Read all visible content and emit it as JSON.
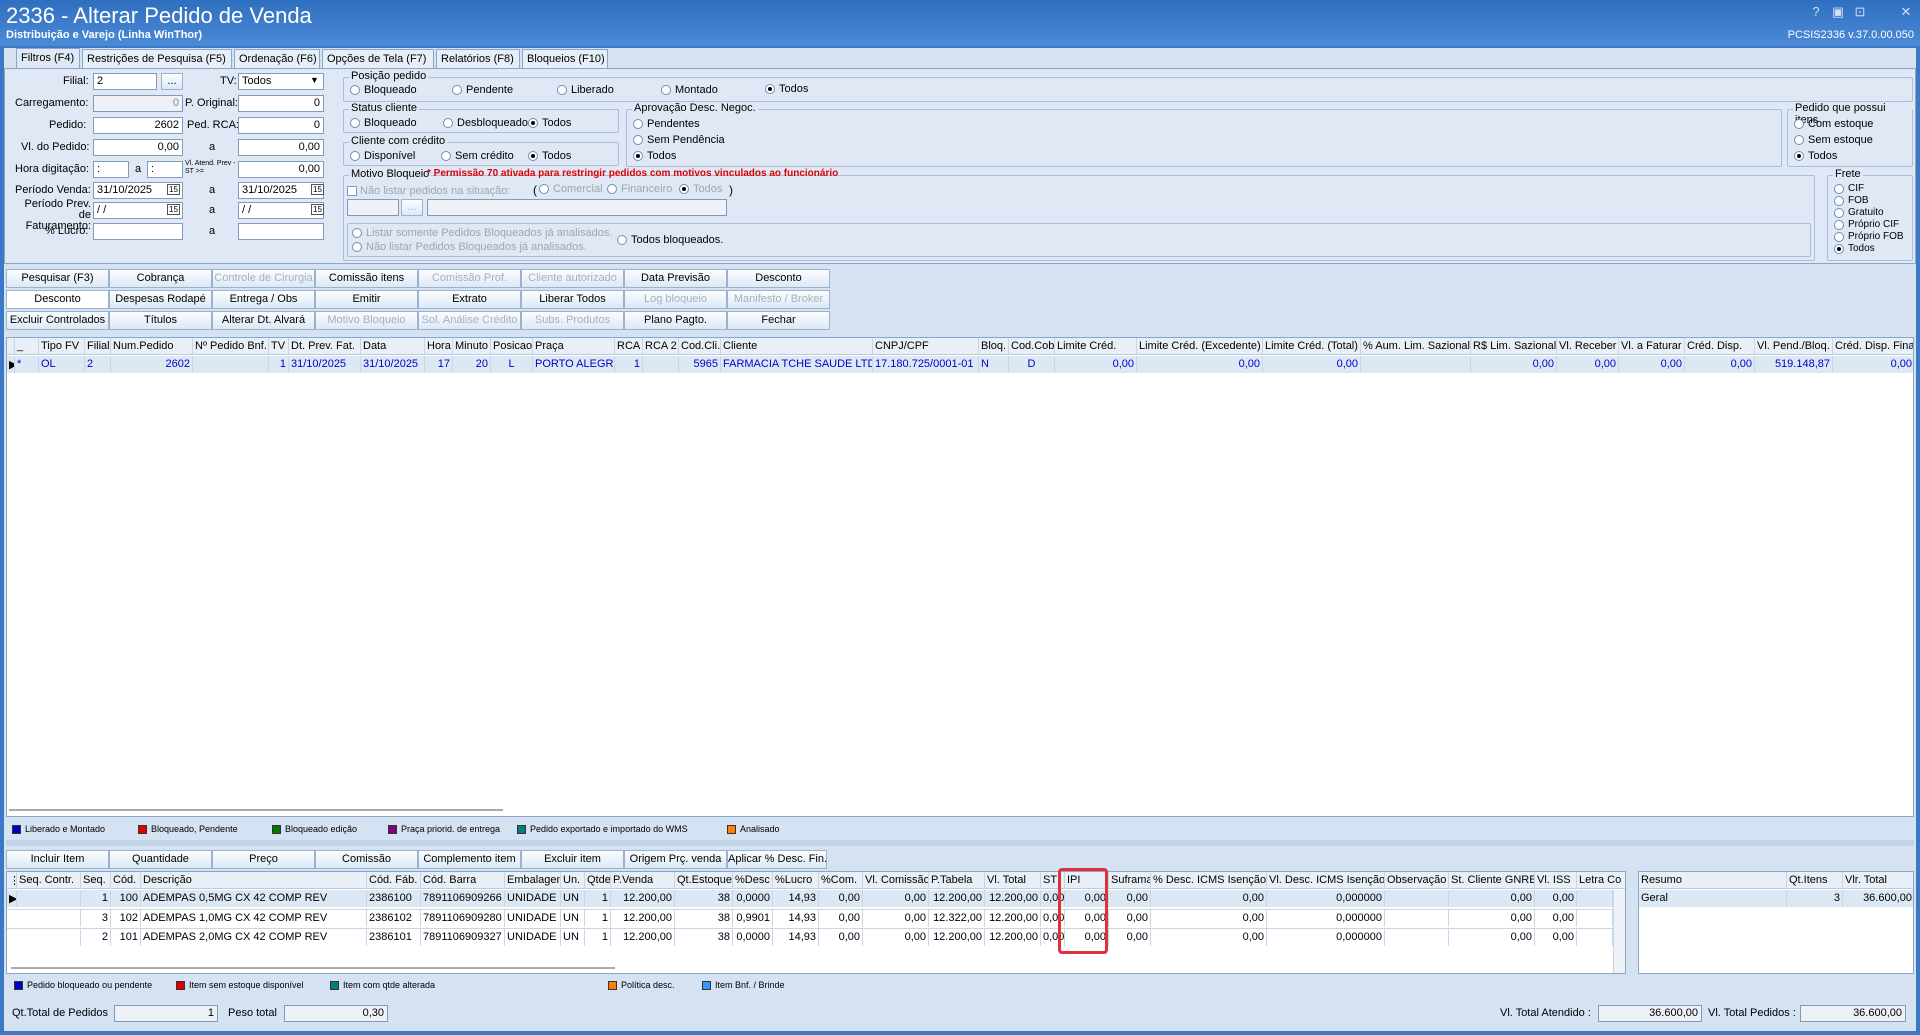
{
  "window": {
    "title": "2336 - Alterar Pedido de Venda",
    "subtitle": "Distribuição e Varejo (Linha WinThor)",
    "version": "PCSIS2336  v.37.0.00.050",
    "controls": [
      "?",
      "▣",
      "⊡",
      "✕"
    ]
  },
  "tabs": [
    "Filtros (F4)",
    "Restrições de Pesquisa (F5)",
    "Ordenação (F6)",
    "Opções de Tela (F7)",
    "Relatórios (F8)",
    "Bloqueios (F10)"
  ],
  "filters": {
    "filial_label": "Filial:",
    "filial_value": "2",
    "ellipsis": "...",
    "tv_label": "TV:",
    "tv_value": "Todos",
    "carregamento_label": "Carregamento:",
    "carregamento_value": "0",
    "p_original_label": "P. Original:",
    "p_original_value": "0",
    "pedido_label": "Pedido:",
    "pedido_value": "2602",
    "ped_rca_label": "Ped. RCA:",
    "ped_rca_value": "0",
    "vl_pedido_label": "Vl. do Pedido:",
    "vl_pedido_from": "0,00",
    "a": "a",
    "vl_pedido_to": "0,00",
    "hora_label": "Hora digitação:",
    "hora_from": ":",
    "hora_to": ":",
    "vl_atend_label": "Vl. Atend. Prev - ST >=",
    "vl_atend_value": "0,00",
    "periodo_venda_label": "Período Venda:",
    "periodo_from": "31/10/2025",
    "periodo_to": "31/10/2025",
    "periodo_prev_label": "Período Prev. de Faturamento:",
    "prev_from": " / /",
    "prev_to": " / /",
    "lucro_label": "% Lucro:",
    "cal": "15"
  },
  "posicao": {
    "title": "Posição pedido",
    "options": [
      "Bloqueado",
      "Pendente",
      "Liberado",
      "Montado",
      "Todos"
    ],
    "selected": "Todos"
  },
  "status_cliente": {
    "title": "Status cliente",
    "options": [
      "Bloqueado",
      "Desbloqueado",
      "Todos"
    ],
    "selected": "Todos"
  },
  "cliente_credito": {
    "title": "Cliente com crédito",
    "options": [
      "Disponível",
      "Sem crédito",
      "Todos"
    ],
    "selected": "Todos"
  },
  "aprovacao": {
    "title": "Aprovação Desc. Negoc.",
    "options": [
      "Pendentes",
      "Sem Pendência",
      "Todos"
    ],
    "selected": "Todos"
  },
  "itens": {
    "title": "Pedido que possui itens",
    "options": [
      "Com estoque",
      "Sem estoque",
      "Todos"
    ],
    "selected": "Todos"
  },
  "frete": {
    "title": "Frete",
    "options": [
      "CIF",
      "FOB",
      "Gratuito",
      "Próprio CIF",
      "Próprio FOB",
      "Todos"
    ],
    "selected": "Todos"
  },
  "motivo": {
    "title": "Motivo Bloqueio",
    "warning": "* Permissão 70 ativada para restringir pedidos com motivos vinculados ao funcionário",
    "nao_listar": "Não listar pedidos na situação:",
    "options": [
      "Comercial",
      "Financeiro",
      "Todos"
    ],
    "listar_bloq": "Listar somente Pedidos Bloqueados já analisados.",
    "nao_listar_bloq": "Não listar Pedidos Bloqueados já analisados.",
    "todos_bloq": "Todos bloqueados."
  },
  "buttons": [
    [
      "Pesquisar (F3)",
      "Cobrança",
      "Controle de Cirurgia",
      "Comissão itens",
      "Comissão Prof.",
      "Cliente autorizado",
      "Data Previsão",
      "Desconto"
    ],
    [
      "Desconto",
      "Despesas Rodapé",
      "Entrega / Obs",
      "Emitir",
      "Extrato",
      "Liberar Todos",
      "Log bloqueio",
      "Manifesto / Broker"
    ],
    [
      "Excluir Controlados",
      "Títulos",
      "Alterar Dt. Alvará",
      "Motivo Bloqueio",
      "Sol. Análise Crédito",
      "Subs. Produtos",
      "Plano Pagto.",
      "Fechar"
    ]
  ],
  "orders": {
    "columns": [
      "_",
      "Tipo FV",
      "Filial",
      "Num.Pedido",
      "Nº Pedido Bnf.",
      "TV",
      "Dt. Prev. Fat.",
      "Data",
      "Hora",
      "Minuto",
      "Posicao",
      "Praça",
      "RCA",
      "RCA 2",
      "Cod.Cli.",
      "Cliente",
      "CNPJ/CPF",
      "Bloq.",
      "Cod.Cob",
      "Limite Créd.",
      "Limite Créd. (Excedente)",
      "Limite Créd. (Total)",
      "% Aum. Lim. Sazional",
      "R$ Lim. Sazional",
      "Vl. Receber",
      "Vl. a Faturar",
      "Créd. Disp.",
      "Vl. Pend./Bloq.",
      "Créd. Disp. Final"
    ],
    "rows": [
      [
        "*",
        "OL",
        "2",
        "2602",
        "",
        "1",
        "31/10/2025",
        "31/10/2025",
        "17",
        "20",
        "L",
        "PORTO ALEGRE",
        "1",
        "",
        "5965",
        "FARMACIA TCHE SAUDE LTDA",
        "17.180.725/0001-01",
        "N",
        "D",
        "0,00",
        "0,00",
        "0,00",
        "",
        "0,00",
        "0,00",
        "0,00",
        "0,00",
        "519.148,87",
        "0,00"
      ]
    ]
  },
  "legend_orders": [
    {
      "label": "Liberado e Montado",
      "color": "#0000c8"
    },
    {
      "label": "Bloqueado, Pendente",
      "color": "#e00000"
    },
    {
      "label": "Bloqueado edição",
      "color": "#007a00"
    },
    {
      "label": "Praça priorid. de entrega",
      "color": "#800080"
    },
    {
      "label": "Pedido exportado e importado do WMS",
      "color": "#008080"
    },
    {
      "label": "Analisado",
      "color": "#ff8000"
    }
  ],
  "item_buttons": [
    "Incluir Item",
    "Quantidade",
    "Preço",
    "Comissão",
    "Complemento item",
    "Excluir item",
    "Origem Prç. venda",
    "Aplicar % Desc. Fin."
  ],
  "items": {
    "columns": [
      "Seq. Contr.",
      "Seq.",
      "Cód.",
      "Descrição",
      "Cód. Fáb.",
      "Cód. Barra",
      "Embalagem",
      "Un.",
      "Qtde",
      "P.Venda",
      "Qt.Estoque",
      "%Desc",
      "%Lucro",
      "%Com.",
      "Vl. Comissão",
      "P.Tabela",
      "Vl. Total",
      "ST",
      "IPI",
      "Suframa",
      "% Desc. ICMS Isenção",
      "Vl. Desc. ICMS Isenção",
      "Observação",
      "St. Cliente GNRE",
      "Vl. ISS",
      "Letra Co"
    ],
    "rows": [
      [
        "",
        "1",
        "100",
        "ADEMPAS 0,5MG CX 42 COMP REV",
        "2386100",
        "7891106909266",
        "UNIDADE",
        "UN",
        "1",
        "12.200,00",
        "38",
        "0,0000",
        "14,93",
        "0,00",
        "0,00",
        "12.200,00",
        "12.200,00",
        "0,00",
        "0,00",
        "0,00",
        "0,00",
        "0,000000",
        "",
        "0,00",
        "0,00",
        ""
      ],
      [
        "",
        "3",
        "102",
        "ADEMPAS 1,0MG CX 42 COMP REV",
        "2386102",
        "7891106909280",
        "UNIDADE",
        "UN",
        "1",
        "12.200,00",
        "38",
        "0,9901",
        "14,93",
        "0,00",
        "0,00",
        "12.322,00",
        "12.200,00",
        "0,00",
        "0,00",
        "0,00",
        "0,00",
        "0,000000",
        "",
        "0,00",
        "0,00",
        ""
      ],
      [
        "",
        "2",
        "101",
        "ADEMPAS 2,0MG CX 42 COMP REV",
        "2386101",
        "7891106909327",
        "UNIDADE",
        "UN",
        "1",
        "12.200,00",
        "38",
        "0,0000",
        "14,93",
        "0,00",
        "0,00",
        "12.200,00",
        "12.200,00",
        "0,00",
        "0,00",
        "0,00",
        "0,00",
        "0,000000",
        "",
        "0,00",
        "0,00",
        ""
      ]
    ]
  },
  "resumo": {
    "columns": [
      "Resumo",
      "Qt.Itens",
      "Vlr. Total"
    ],
    "rows": [
      [
        "Geral",
        "3",
        "36.600,00"
      ]
    ]
  },
  "legend_items": [
    {
      "label": "Pedido bloqueado ou pendente",
      "color": "#0000c8"
    },
    {
      "label": "Item sem estoque disponível",
      "color": "#e00000"
    },
    {
      "label": "Item com qtde alterada",
      "color": "#008080"
    },
    {
      "label": "Política desc.",
      "color": "#ff8000"
    },
    {
      "label": "Item Bnf. / Brinde",
      "color": "#3399ff"
    }
  ],
  "footer": {
    "qt_label": "Qt.Total de Pedidos",
    "qt_value": "1",
    "peso_label": "Peso total",
    "peso_value": "0,30",
    "atendido_label": "Vl. Total Atendido :",
    "atendido_value": "36.600,00",
    "pedidos_label": "Vl. Total Pedidos :",
    "pedidos_value": "36.600,00"
  },
  "highlight_color": "#e0303a"
}
